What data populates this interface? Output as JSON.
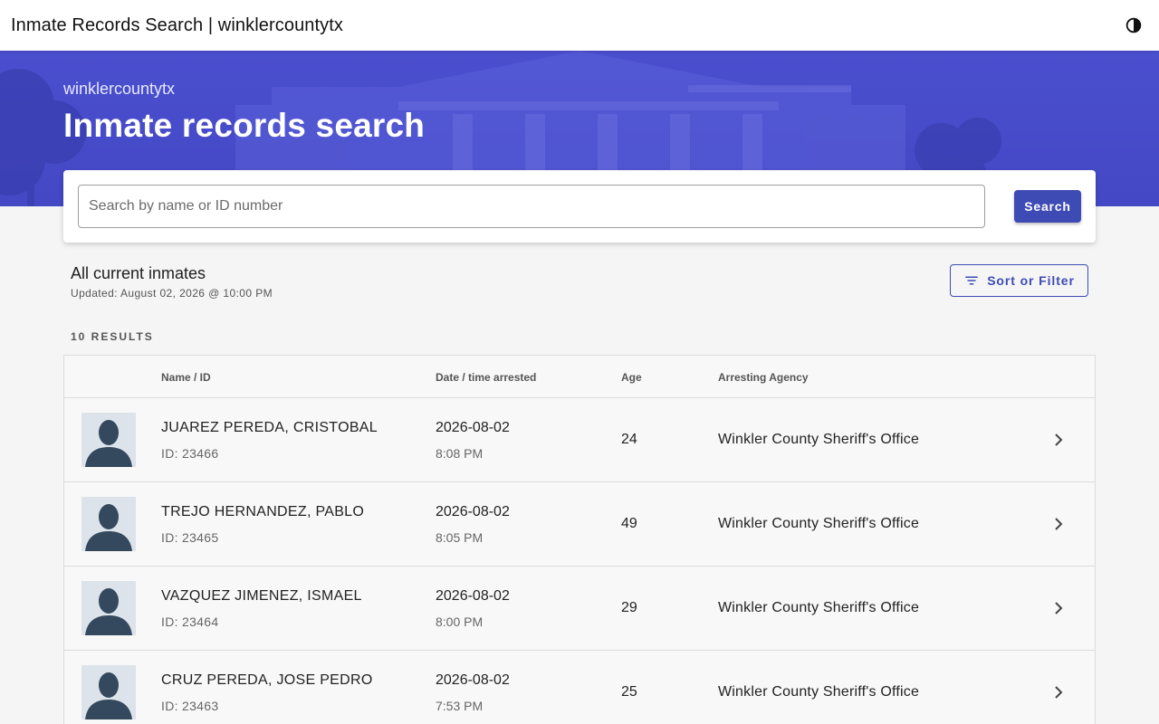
{
  "app": {
    "window_title": "Inmate Records Search | winklercountytx",
    "theme_toggle_icon": "dark-mode-icon"
  },
  "hero": {
    "subtitle": "winklercountytx",
    "title": "Inmate records search",
    "background_color": "#4a4fcf"
  },
  "search": {
    "placeholder": "Search by name or ID number",
    "value": "",
    "button_label": "Search"
  },
  "list": {
    "title": "All current inmates",
    "updated": "Updated: August 02, 2026 @ 10:00 PM",
    "sort_filter_label": "Sort or Filter",
    "sort_filter_icon": "filter-list-icon",
    "results_count": "10 RESULTS"
  },
  "table": {
    "columns": {
      "name": "Name / ID",
      "date": "Date / time arrested",
      "age": "Age",
      "agency": "Arresting Agency"
    },
    "rows": [
      {
        "name": "JUAREZ PEREDA, CRISTOBAL",
        "id": "ID: 23466",
        "date": "2026-08-02",
        "time": "8:08 PM",
        "age": "24",
        "agency": "Winkler County Sheriff's Office"
      },
      {
        "name": "TREJO HERNANDEZ, PABLO",
        "id": "ID: 23465",
        "date": "2026-08-02",
        "time": "8:05 PM",
        "age": "49",
        "agency": "Winkler County Sheriff's Office"
      },
      {
        "name": "VAZQUEZ JIMENEZ, ISMAEL",
        "id": "ID: 23464",
        "date": "2026-08-02",
        "time": "8:00 PM",
        "age": "29",
        "agency": "Winkler County Sheriff's Office"
      },
      {
        "name": "CRUZ PEREDA, JOSE PEDRO",
        "id": "ID: 23463",
        "date": "2026-08-02",
        "time": "7:53 PM",
        "age": "25",
        "agency": "Winkler County Sheriff's Office"
      }
    ]
  },
  "colors": {
    "primary": "#3f4bb5",
    "avatar_bg": "#dde3ea",
    "avatar_silhouette": "#34495e"
  }
}
